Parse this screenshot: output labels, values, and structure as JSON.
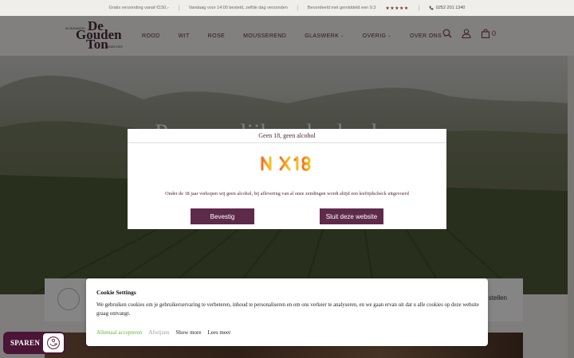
{
  "topbar": {
    "items": [
      "Gratis verzending vanaf €150,-",
      "Vandaag voor 14:00 besteld, zelfde dag verzonden",
      "Beoordeeld met gemiddeld een 9.3"
    ],
    "stars": "★★★★★",
    "phone": "0252 201 1340"
  },
  "header": {
    "logo_top_text": "WIJNHANDEL",
    "logo_line1": "De",
    "logo_line2": "Gouden",
    "logo_line3": "Ton",
    "logo_bottom_text": "SINDS 1923",
    "nav": [
      {
        "label": "ROOD",
        "dropdown": false
      },
      {
        "label": "WIT",
        "dropdown": false
      },
      {
        "label": "ROSE",
        "dropdown": false
      },
      {
        "label": "MOUSSEREND",
        "dropdown": false
      },
      {
        "label": "GLASWERK",
        "dropdown": true
      },
      {
        "label": "OVERIG",
        "dropdown": true
      },
      {
        "label": "OVER ONS",
        "dropdown": true
      }
    ],
    "chevron": "⌄",
    "cart_count": "0"
  },
  "hero": {
    "title": "Puur, eerlijk en herkenbaar"
  },
  "features": {
    "right_text": "stellen"
  },
  "age_modal": {
    "title": "Geen 18, geen alcohol",
    "logo_text": "NIX18",
    "text": "Onder de 18 jaar verkopen wij geen alcohol, bij aflevering van al onze zendingen wordt altijd een leeftijdscheck uitgevoerd",
    "confirm_label": "Bevestig",
    "close_label": "Sluit deze website"
  },
  "cookie": {
    "title": "Cookie Settings",
    "text": "We gebruiken cookies om je gebruikerservaring te verbeteren, inhoud te personaliseren en om ons verkeer te analyseren, en we gaan ervan uit dat u alle cookies op deze website graag ontvangt.",
    "accept_label": "Allemaal accepteren",
    "decline_label": "Afwijzen",
    "show_more_label": "Show more",
    "read_more_label": "Lees meer"
  },
  "sparen": {
    "label": "SPAREN"
  },
  "colors": {
    "brand": "#5e2a4a",
    "accept": "#69b23c"
  }
}
